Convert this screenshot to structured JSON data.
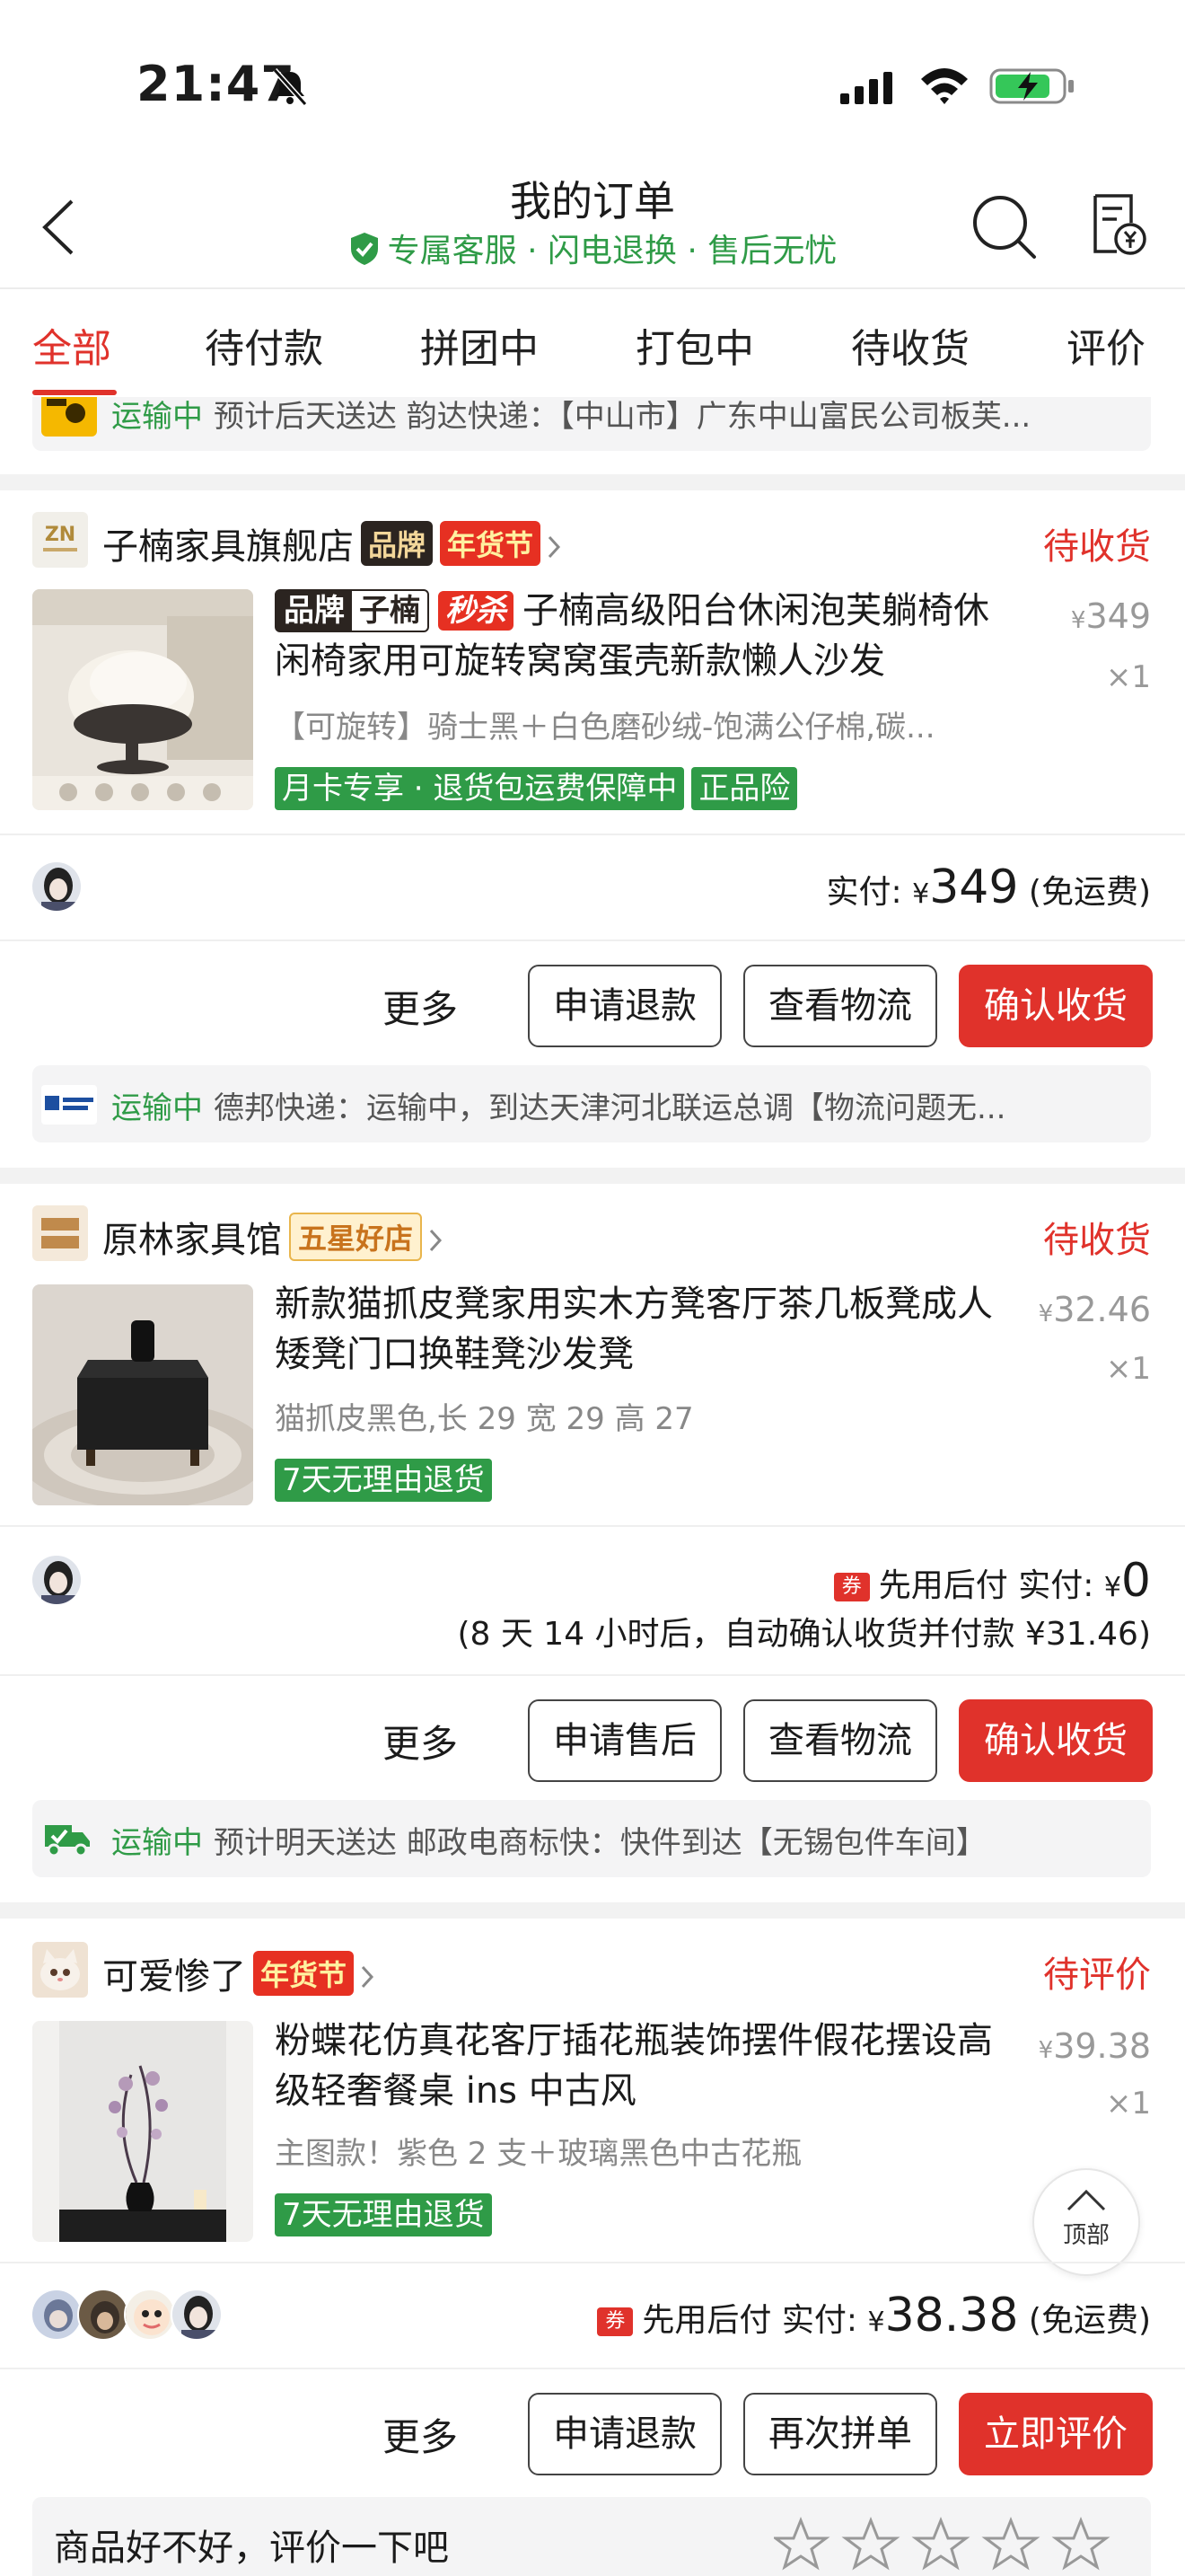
{
  "status_bar": {
    "time": "21:47"
  },
  "nav": {
    "title": "我的订单",
    "subtitle": "专属客服 · 闪电退换 · 售后无忧"
  },
  "tabs": [
    "全部",
    "待付款",
    "拼团中",
    "打包中",
    "待收货",
    "评价"
  ],
  "top_logistics": {
    "status": "运输中",
    "text": "预计后天送达 韵达快递：【中山市】广东中山富民公司板芙..."
  },
  "orders": [
    {
      "shop": "子楠家具旗舰店",
      "badges": [
        "品牌",
        "年货节"
      ],
      "status": "待收货",
      "title_tags": {
        "brand_left": "品牌",
        "brand_right": "子楠",
        "flash": "秒杀"
      },
      "title": "子楠高级阳台休闲泡芙躺椅休闲椅家用可旋转窝窝蛋壳新款懒人沙发",
      "spec": "【可旋转】骑士黑＋白色磨砂绒-饱满公仔棉,碳...",
      "price_cur": "¥",
      "price": "349",
      "qty": "×1",
      "tags": [
        "月卡专享 · 退货包运费保障中",
        "正品险"
      ],
      "pay_label": "实付:",
      "pay_cur": "¥",
      "pay_amount": "349",
      "pay_suffix": "(免运费)",
      "more": "更多",
      "buttons": [
        "申请退款",
        "查看物流",
        "确认收货"
      ],
      "logistics_status": "运输中",
      "logistics_text": "德邦快递：运输中，到达天津河北联运总调【物流问题无..."
    },
    {
      "shop": "原林家具馆",
      "badges": [
        "五星好店"
      ],
      "status": "待收货",
      "title": "新款猫抓皮凳家用实木方凳客厅茶几板凳成人矮凳门口换鞋凳沙发凳",
      "spec": "猫抓皮黑色,长 29 宽 29 高 27",
      "price_cur": "¥",
      "price": "32.46",
      "qty": "×1",
      "tags": [
        "7天无理由退货"
      ],
      "coupon": "券",
      "pay_prefix": "先用后付",
      "pay_label": "实付:",
      "pay_cur": "¥",
      "pay_amount": "0",
      "pay_note": "(8 天 14 小时后，自动确认收货并付款 ¥31.46)",
      "more": "更多",
      "buttons": [
        "申请售后",
        "查看物流",
        "确认收货"
      ],
      "logistics_status": "运输中",
      "logistics_text": "预计明天送达 邮政电商标快：快件到达【无锡包件车间】"
    },
    {
      "shop": "可爱惨了",
      "badges": [
        "年货节"
      ],
      "status": "待评价",
      "title": "粉蝶花仿真花客厅插花瓶装饰摆件假花摆设高级轻奢餐桌 ins 中古风",
      "spec": "主图款！紫色 2 支＋玻璃黑色中古花瓶",
      "price_cur": "¥",
      "price": "39.38",
      "qty": "×1",
      "tags": [
        "7天无理由退货"
      ],
      "coupon": "券",
      "pay_prefix": "先用后付",
      "pay_label": "实付:",
      "pay_cur": "¥",
      "pay_amount": "38.38",
      "pay_suffix": "(免运费)",
      "more": "更多",
      "buttons": [
        "申请退款",
        "再次拼单",
        "立即评价"
      ]
    }
  ],
  "back_to_top": "顶部",
  "review_prompt": "商品好不好，评价一下吧",
  "colors": {
    "accent": "#e0322b",
    "green": "#2f9b47"
  }
}
